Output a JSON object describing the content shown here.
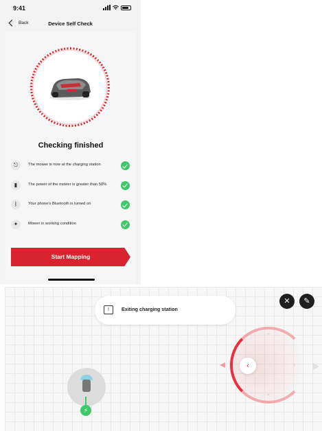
{
  "status_bar": {
    "time": "9:41"
  },
  "nav": {
    "back_label": "Back",
    "title": "Device Self Check"
  },
  "status": {
    "heading": "Checking finished"
  },
  "checks": [
    {
      "icon": "charging-station-icon",
      "text": "The mower is now at the charging station",
      "status": "ok"
    },
    {
      "icon": "battery-icon",
      "text": "The power of the mower is greater than 50%",
      "status": "ok"
    },
    {
      "icon": "bluetooth-icon",
      "text": "Your phone's Bluetooth is turned on",
      "status": "ok"
    },
    {
      "icon": "mower-condition-icon",
      "text": "Mower in working condition",
      "status": "ok"
    }
  ],
  "primary_button": {
    "label": "Start Mapping"
  },
  "map": {
    "toast": {
      "text": "Exiting charging station"
    },
    "buttons": {
      "close_icon": "close-icon",
      "edit_icon": "edit-icon"
    }
  },
  "colors": {
    "accent": "#d9232e",
    "success": "#3ec86a",
    "background": "#f3f3f3"
  }
}
